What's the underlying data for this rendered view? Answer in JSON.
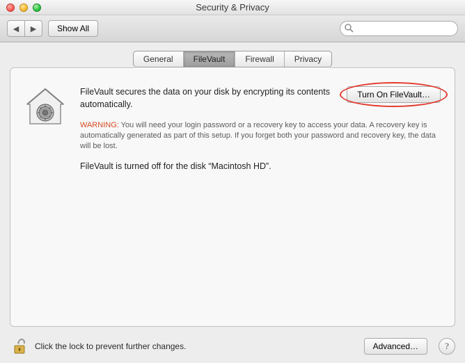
{
  "window": {
    "title": "Security & Privacy"
  },
  "toolbar": {
    "back_nav_aria": "Back",
    "forward_nav_aria": "Forward",
    "show_all_label": "Show All",
    "search_placeholder": ""
  },
  "tabs": [
    {
      "label": "General",
      "active": false
    },
    {
      "label": "FileVault",
      "active": true
    },
    {
      "label": "Firewall",
      "active": false
    },
    {
      "label": "Privacy",
      "active": false
    }
  ],
  "filevault": {
    "description": "FileVault secures the data on your disk by encrypting its contents automatically.",
    "turn_on_label": "Turn On FileVault…",
    "warning_label": "WARNING:",
    "warning_text": "You will need your login password or a recovery key to access your data. A recovery key is automatically generated as part of this setup. If you forget both your password and recovery key, the data will be lost.",
    "status_text": "FileVault is turned off for the disk “Macintosh HD”."
  },
  "footer": {
    "lock_text": "Click the lock to prevent further changes.",
    "advanced_label": "Advanced…",
    "help_label": "?"
  }
}
